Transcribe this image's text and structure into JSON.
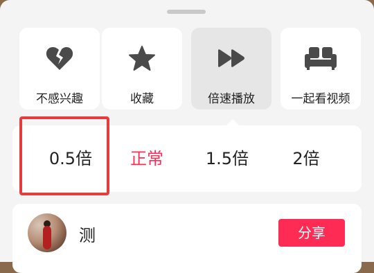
{
  "actions": [
    {
      "label": "不感兴趣",
      "icon": "broken-heart-icon"
    },
    {
      "label": "收藏",
      "icon": "star-icon"
    },
    {
      "label": "倍速播放",
      "icon": "fast-forward-icon"
    },
    {
      "label": "一起看视频",
      "icon": "sofa-icon"
    }
  ],
  "speeds": {
    "options": [
      "0.5倍",
      "正常",
      "1.5倍",
      "2倍"
    ],
    "selected": "正常"
  },
  "share": {
    "user_name": "测",
    "button_label": "分享"
  },
  "colors": {
    "accent": "#fe2c55",
    "highlight_border": "#e43d3f",
    "icon": "#4a4a4a"
  }
}
